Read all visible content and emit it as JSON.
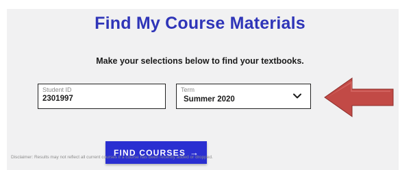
{
  "header": {
    "title": "Find My Course Materials",
    "subtitle": "Make your selections below to find your textbooks."
  },
  "form": {
    "student_id": {
      "label": "Student ID",
      "value": "2301997"
    },
    "term": {
      "label": "Term",
      "value": "Summer 2020"
    }
  },
  "actions": {
    "find_label": "FIND COURSES",
    "find_arrow": "→"
  },
  "footer": {
    "disclaimer": "Disclaimer: Results may not reflect all current courses if a course has been recently added or dropped."
  },
  "colors": {
    "brand": "#2f35b8",
    "button": "#2a2fd1",
    "annotation_arrow": "#c24a46"
  },
  "icons": {
    "dropdown": "chevron-down-icon",
    "annotation": "arrow-left-icon"
  }
}
